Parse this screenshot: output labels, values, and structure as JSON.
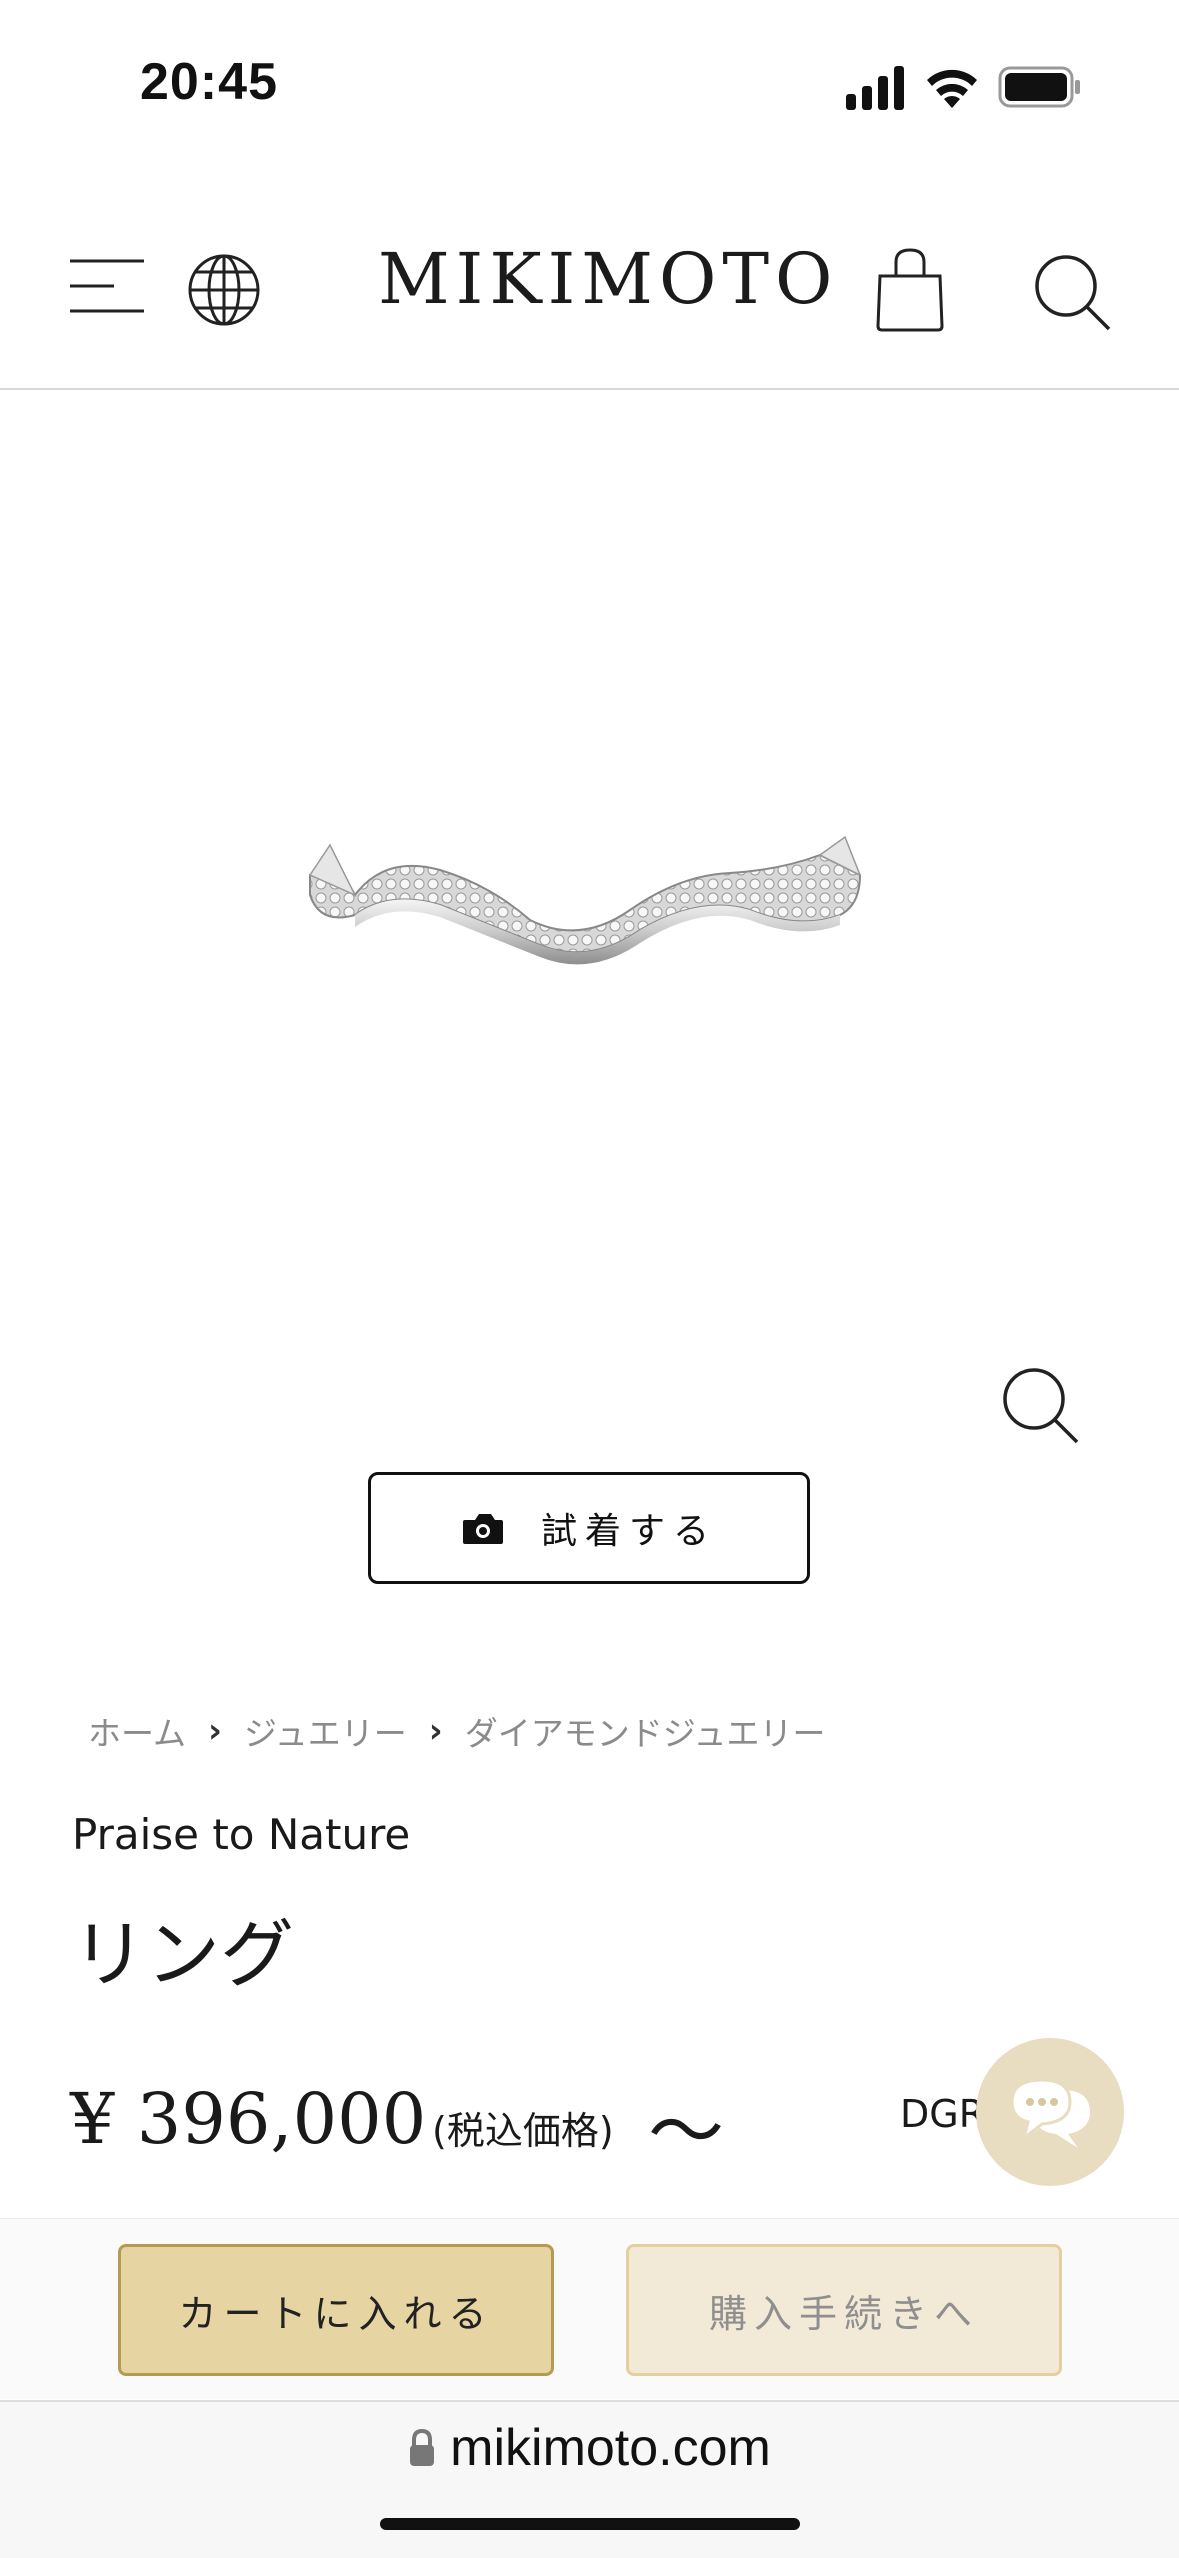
{
  "status_bar": {
    "time": "20:45"
  },
  "header": {
    "logo": "MIKIMOTO"
  },
  "product": {
    "tryon_label": "試着する",
    "collection": "Praise to Nature",
    "name": "リング",
    "price": "¥ 396,000",
    "tax_label": "(税込価格)",
    "price_suffix": "〜",
    "code": "DGR"
  },
  "breadcrumb": {
    "items": [
      "ホーム",
      "ジュエリー",
      "ダイアモンドジュエリー"
    ],
    "separator": "›"
  },
  "actions": {
    "cart_label": "カートに入れる",
    "checkout_label": "購入手続きへ"
  },
  "browser": {
    "url": "mikimoto.com"
  },
  "colors": {
    "accent_gold": "#e6d4a3",
    "accent_gold_border": "#b69a52",
    "disabled_gold": "#f2ead7",
    "chat_bg": "#e8dcc1"
  },
  "icons": {
    "menu": "menu-icon",
    "globe": "globe-icon",
    "bag": "shopping-bag-icon",
    "search": "search-icon",
    "zoom": "zoom-icon",
    "camera": "camera-icon",
    "chat": "chat-bubble-icon",
    "lock": "lock-icon"
  }
}
